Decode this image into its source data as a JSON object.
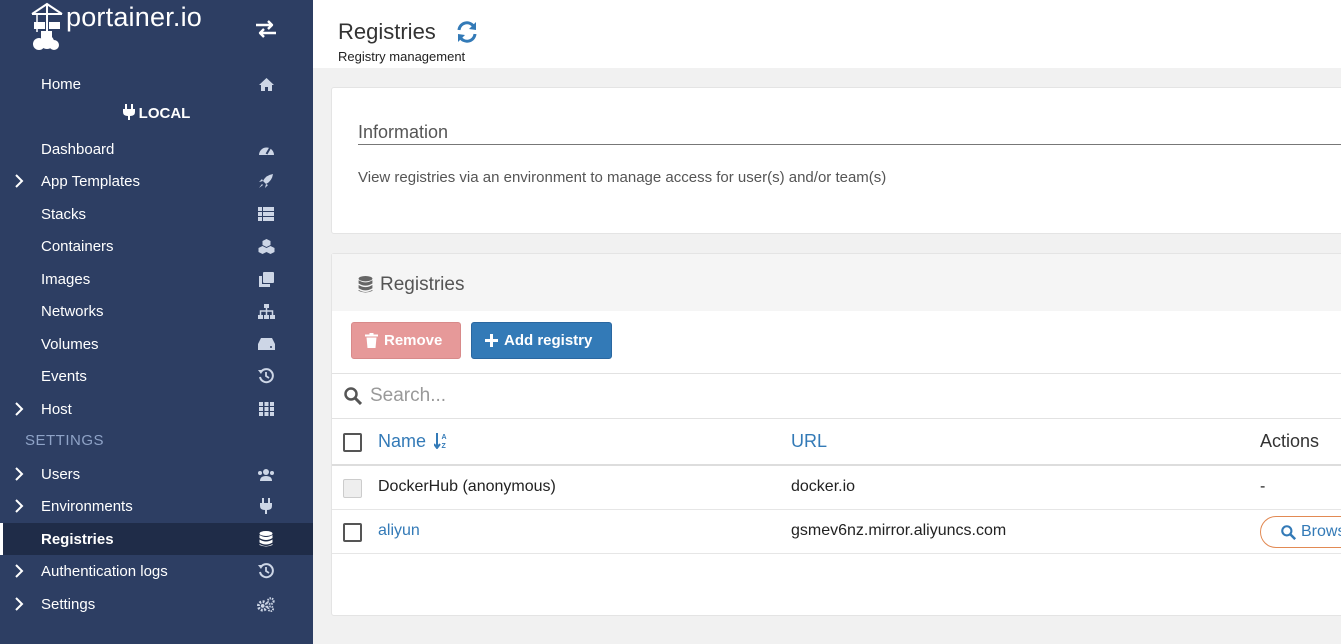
{
  "brand": {
    "logo_text": "portainer.io"
  },
  "sidebar": {
    "home_label": "Home",
    "environment_name": "LOCAL",
    "env_items": [
      {
        "label": "Dashboard",
        "icon": "dashboard-icon"
      },
      {
        "label": "App Templates",
        "icon": "rocket-icon",
        "expandable": true
      },
      {
        "label": "Stacks",
        "icon": "list-icon"
      },
      {
        "label": "Containers",
        "icon": "cubes-icon"
      },
      {
        "label": "Images",
        "icon": "clone-icon"
      },
      {
        "label": "Networks",
        "icon": "sitemap-icon"
      },
      {
        "label": "Volumes",
        "icon": "hdd-icon"
      },
      {
        "label": "Events",
        "icon": "history-icon"
      },
      {
        "label": "Host",
        "icon": "th-icon",
        "expandable": true
      }
    ],
    "settings_section_title": "SETTINGS",
    "settings_items": [
      {
        "label": "Users",
        "icon": "users-icon",
        "expandable": true
      },
      {
        "label": "Environments",
        "icon": "plug-icon",
        "expandable": true
      },
      {
        "label": "Registries",
        "icon": "database-icon",
        "active": true
      },
      {
        "label": "Authentication logs",
        "icon": "history-icon",
        "expandable": true
      },
      {
        "label": "Settings",
        "icon": "cogs-icon",
        "expandable": true
      }
    ]
  },
  "header": {
    "title": "Registries",
    "subtitle": "Registry management"
  },
  "info": {
    "title": "Information",
    "text": "View registries via an environment to manage access for user(s) and/or team(s)"
  },
  "registries": {
    "title": "Registries",
    "remove_label": "Remove",
    "add_label": "Add registry",
    "search_placeholder": "Search...",
    "columns": {
      "name": "Name",
      "url": "URL",
      "actions": "Actions"
    },
    "rows": [
      {
        "name": "DockerHub (anonymous)",
        "url": "docker.io",
        "action": "-"
      },
      {
        "name": "aliyun",
        "url": "gsmev6nz.mirror.aliyuncs.com",
        "action": "Browse"
      }
    ]
  },
  "colors": {
    "sidebar_bg": "#2d3e63",
    "sidebar_active": "#1f2c48",
    "accent": "#337ab7",
    "danger_disabled": "#e69999"
  }
}
